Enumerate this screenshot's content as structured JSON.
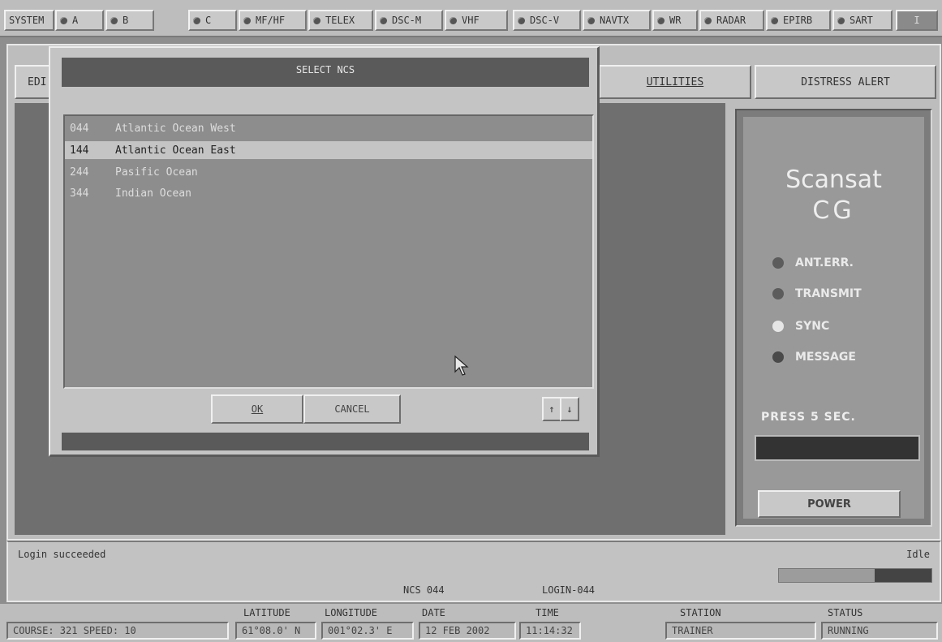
{
  "topbar": {
    "tabs": [
      {
        "label": "SYSTEM",
        "dot": false
      },
      {
        "label": "A",
        "dot": true
      },
      {
        "label": "B",
        "dot": true
      },
      {
        "label": "C",
        "dot": true
      },
      {
        "label": "MF/HF",
        "dot": true
      },
      {
        "label": "TELEX",
        "dot": true
      },
      {
        "label": "DSC-M",
        "dot": true
      },
      {
        "label": "VHF",
        "dot": true
      },
      {
        "label": "DSC-V",
        "dot": true
      },
      {
        "label": "NAVTX",
        "dot": true
      },
      {
        "label": "WR",
        "dot": true
      },
      {
        "label": "RADAR",
        "dot": true
      },
      {
        "label": "EPIRB",
        "dot": true
      },
      {
        "label": "SART",
        "dot": true
      }
    ],
    "end_label": "I"
  },
  "menu": {
    "edit_partial": "EDI",
    "utilities": "UTILITIES",
    "distress": "DISTRESS ALERT"
  },
  "dialog": {
    "title": "SELECT NCS",
    "items": [
      {
        "code": "044",
        "name": "Atlantic Ocean West",
        "selected": false
      },
      {
        "code": "144",
        "name": "Atlantic Ocean East",
        "selected": true
      },
      {
        "code": "244",
        "name": "Pasific Ocean",
        "selected": false
      },
      {
        "code": "344",
        "name": "Indian Ocean",
        "selected": false
      }
    ],
    "ok": "OK",
    "cancel": "CANCEL",
    "up": "↑",
    "down": "↓"
  },
  "panel": {
    "brand_line1": "Scansat",
    "brand_line2": "CG",
    "indicators": [
      {
        "label": "ANT.ERR.",
        "color": "#5c5c5c"
      },
      {
        "label": "TRANSMIT",
        "color": "#5c5c5c"
      },
      {
        "label": "SYNC",
        "color": "#e6e6e6"
      },
      {
        "label": "MESSAGE",
        "color": "#4a4a4a"
      }
    ],
    "press_label": "PRESS 5 SEC.",
    "power": "POWER"
  },
  "status": {
    "message": "Login succeeded",
    "state": "Idle",
    "ncs": "NCS 044",
    "login": "LOGIN-044",
    "progress": 0.37
  },
  "infobar": {
    "course_speed": "COURSE: 321   SPEED: 10",
    "headers": {
      "latitude": "LATITUDE",
      "longitude": "LONGITUDE",
      "date": "DATE",
      "time": "TIME",
      "station": "STATION",
      "status": "STATUS"
    },
    "values": {
      "latitude": "61°08.0' N",
      "longitude": "001°02.3' E",
      "date": "12 FEB 2002",
      "time": "11:14:32",
      "station": "TRAINER",
      "status": "RUNNING"
    }
  }
}
